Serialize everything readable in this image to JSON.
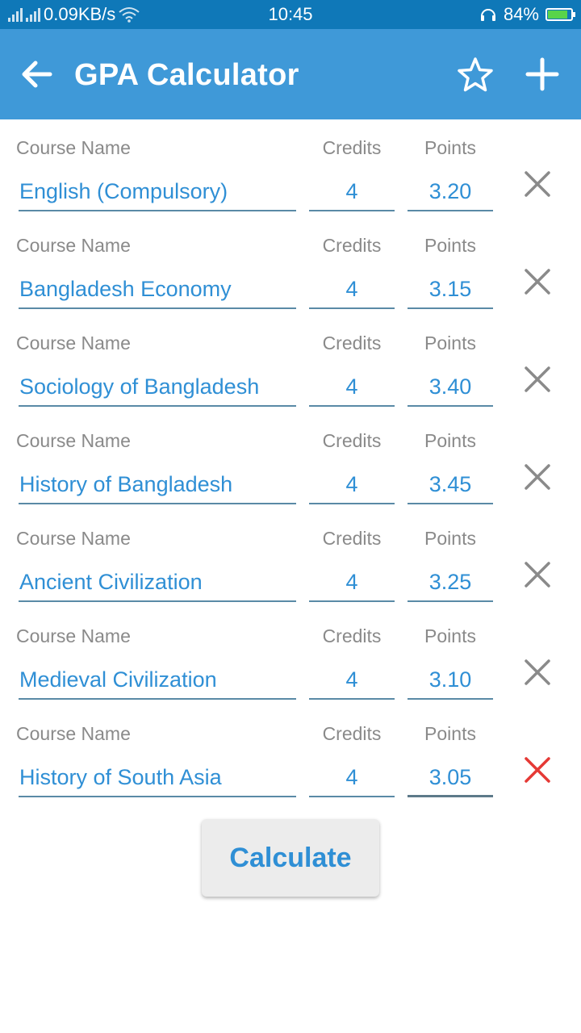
{
  "status_bar": {
    "network_speed": "0.09KB/s",
    "time": "10:45",
    "battery": "84%",
    "battery_level": 0.84
  },
  "app_bar": {
    "title": "GPA Calculator",
    "back_icon": "arrow-left-icon",
    "favorite_icon": "star-outline-icon",
    "add_icon": "plus-icon"
  },
  "labels": {
    "course_name": "Course Name",
    "credits": "Credits",
    "points": "Points"
  },
  "courses": [
    {
      "name": "English (Compulsory)",
      "credits": "4",
      "points": "3.20"
    },
    {
      "name": "Bangladesh Economy",
      "credits": "4",
      "points": "3.15"
    },
    {
      "name": "Sociology of Bangladesh",
      "credits": "4",
      "points": "3.40"
    },
    {
      "name": "History of Bangladesh",
      "credits": "4",
      "points": "3.45"
    },
    {
      "name": "Ancient Civilization",
      "credits": "4",
      "points": "3.25"
    },
    {
      "name": "Medieval Civilization",
      "credits": "4",
      "points": "3.10"
    },
    {
      "name": "History of South Asia",
      "credits": "4",
      "points": "3.05"
    }
  ],
  "delete_icon_color": "#8a8a8a",
  "delete_icon_active_color": "#e53935",
  "calculate_label": "Calculate",
  "colors": {
    "status_bar": "#0f78b8",
    "app_bar": "#3f99d8",
    "accent_text": "#2f8fd5"
  }
}
